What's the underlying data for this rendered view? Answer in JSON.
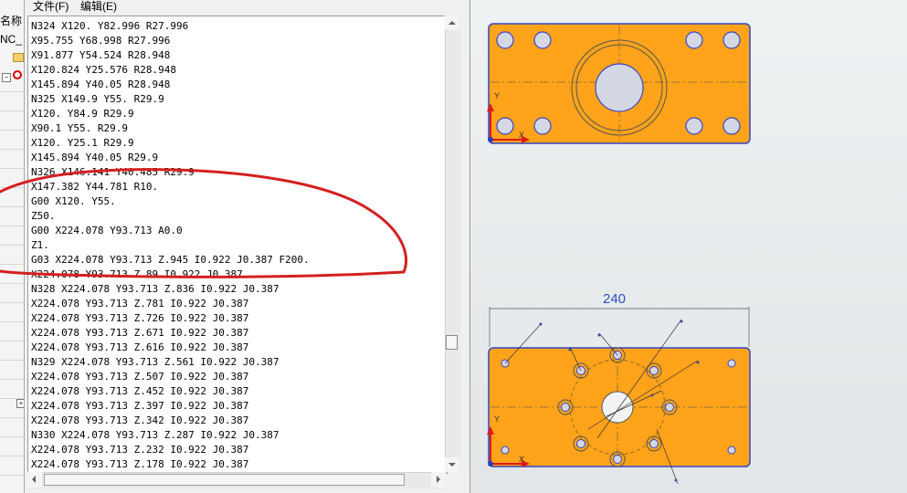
{
  "left_panel": {
    "column_header": "名称",
    "nc_label": "NC_"
  },
  "editor": {
    "menu": [
      "文件(F)",
      "编辑(E)"
    ],
    "lines": [
      "N324 X120. Y82.996 R27.996",
      "X95.755 Y68.998 R27.996",
      "X91.877 Y54.524 R28.948",
      "X120.824 Y25.576 R28.948",
      "X145.894 Y40.05 R28.948",
      "N325 X149.9 Y55. R29.9",
      "X120. Y84.9 R29.9",
      "X90.1 Y55. R29.9",
      "X120. Y25.1 R29.9",
      "X145.894 Y40.05 R29.9",
      "N326 X146.141 Y40.485 R29.9",
      "X147.382 Y44.781 R10.",
      "G00 X120. Y55.",
      "Z50.",
      "G00 X224.078 Y93.713 A0.0",
      "Z1.",
      "G03 X224.078 Y93.713 Z.945 I0.922 J0.387 F200.",
      "X224.078 Y93.713 Z.89 I0.922 J0.387",
      "N328 X224.078 Y93.713 Z.836 I0.922 J0.387",
      "X224.078 Y93.713 Z.781 I0.922 J0.387",
      "X224.078 Y93.713 Z.726 I0.922 J0.387",
      "X224.078 Y93.713 Z.671 I0.922 J0.387",
      "X224.078 Y93.713 Z.616 I0.922 J0.387",
      "N329 X224.078 Y93.713 Z.561 I0.922 J0.387",
      "X224.078 Y93.713 Z.507 I0.922 J0.387",
      "X224.078 Y93.713 Z.452 I0.922 J0.387",
      "X224.078 Y93.713 Z.397 I0.922 J0.387",
      "X224.078 Y93.713 Z.342 I0.922 J0.387",
      "N330 X224.078 Y93.713 Z.287 I0.922 J0.387",
      "X224.078 Y93.713 Z.232 I0.922 J0.387",
      "X224.078 Y93.713 Z.178 I0.922 J0.387"
    ]
  },
  "cad": {
    "dimension_label": "240",
    "axis_y": "Y",
    "axis_x": "X"
  },
  "colors": {
    "part_fill": "#ffa31a",
    "part_outline": "#3545c8",
    "hole_fill": "#d4d7e4",
    "annotation_red": "#d42020",
    "annotation_circle": "#c82828",
    "viewport_bg": "#e7ebed"
  }
}
